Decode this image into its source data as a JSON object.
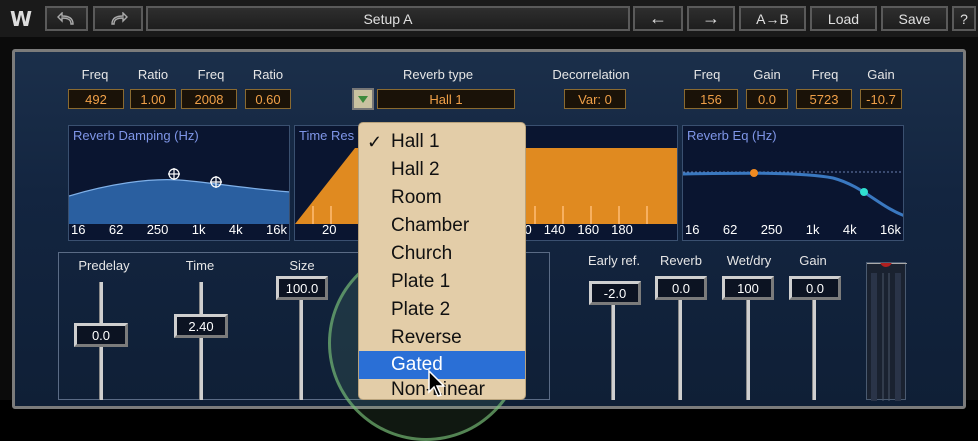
{
  "toolbar": {
    "logo": "W",
    "undo_icon": "undo-icon",
    "redo_icon": "redo-icon",
    "setup": "Setup A",
    "prev": "←",
    "next": "→",
    "ab": "A→B",
    "load": "Load",
    "save": "Save",
    "help": "?"
  },
  "params": {
    "left": [
      {
        "label": "Freq",
        "value": "492"
      },
      {
        "label": "Ratio",
        "value": "1.00"
      },
      {
        "label": "Freq",
        "value": "2008"
      },
      {
        "label": "Ratio",
        "value": "0.60"
      }
    ],
    "reverb_type_label": "Reverb type",
    "reverb_type_value": "Hall 1",
    "decorrelation_label": "Decorrelation",
    "decorrelation_value": "Var: 0",
    "right": [
      {
        "label": "Freq",
        "value": "156"
      },
      {
        "label": "Gain",
        "value": "0.0"
      },
      {
        "label": "Freq",
        "value": "5723"
      },
      {
        "label": "Gain",
        "value": "-10.7"
      }
    ]
  },
  "graphs": {
    "damping": {
      "title": "Reverb Damping (Hz)",
      "ticks": [
        "16",
        "62",
        "250",
        "1k",
        "4k",
        "16k"
      ]
    },
    "time": {
      "title": "Time Res",
      "ticks_left": "20",
      "ticks_right": [
        "0",
        "140",
        "160",
        "180"
      ]
    },
    "eq": {
      "title": "Reverb Eq (Hz)",
      "ticks": [
        "16",
        "62",
        "250",
        "1k",
        "4k",
        "16k"
      ]
    }
  },
  "faders_left": [
    {
      "label": "Predelay",
      "value": "0.0"
    },
    {
      "label": "Time",
      "value": "2.40"
    },
    {
      "label": "Size",
      "value": "100.0"
    }
  ],
  "faders_right": [
    {
      "label": "Early ref.",
      "value": "-2.0"
    },
    {
      "label": "Reverb",
      "value": "0.0"
    },
    {
      "label": "Wet/dry",
      "value": "100"
    },
    {
      "label": "Gain",
      "value": "0.0"
    }
  ],
  "menu": {
    "items": [
      "Hall 1",
      "Hall 2",
      "Room",
      "Chamber",
      "Church",
      "Plate 1",
      "Plate 2",
      "Reverse",
      "Gated",
      "Non-Linear"
    ],
    "checked": "✓",
    "selected_index": 8
  },
  "colors": {
    "accent_orange": "#f0a048",
    "graph_blue": "#2a6fb0",
    "menu_highlight": "#2a6fd6"
  }
}
